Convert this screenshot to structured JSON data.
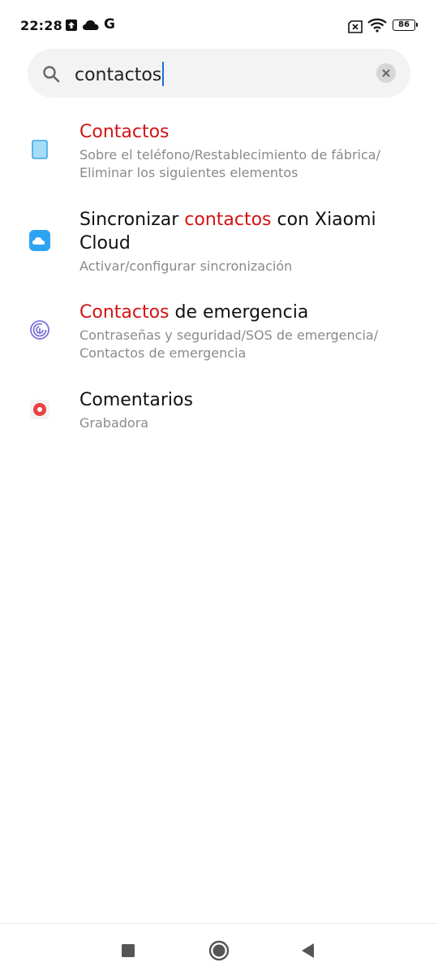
{
  "status_bar": {
    "time": "22:28",
    "g_label": "G",
    "battery": "86",
    "icons": [
      "upload-icon",
      "cloud-icon",
      "g-icon",
      "no-sim-icon",
      "wifi-icon",
      "battery-icon"
    ]
  },
  "search": {
    "value": "contactos",
    "placeholder": ""
  },
  "results": [
    {
      "icon": "phone-device-icon",
      "title_hl": "Contactos",
      "title_rest": "",
      "subtitle": "Sobre el teléfono/Restablecimiento de fábrica/ Eliminar los siguientes elementos"
    },
    {
      "icon": "xiaomi-cloud-icon",
      "title_pre": "Sincronizar ",
      "title_hl": "contactos",
      "title_rest": " con Xiaomi Cloud",
      "subtitle": "Activar/configurar sincronización"
    },
    {
      "icon": "fingerprint-icon",
      "title_hl": "Contactos",
      "title_rest": " de emergencia",
      "subtitle": "Contraseñas y seguridad/SOS de emergencia/ Contactos de emergencia"
    },
    {
      "icon": "recorder-icon",
      "title": "Comentarios",
      "subtitle": "Grabadora"
    }
  ],
  "colors": {
    "highlight": "#d21414",
    "caret": "#1e6fd9",
    "subtitle": "#8a8a8a"
  },
  "nav_bar": {
    "buttons": [
      "recents-button",
      "home-button",
      "back-button"
    ]
  }
}
